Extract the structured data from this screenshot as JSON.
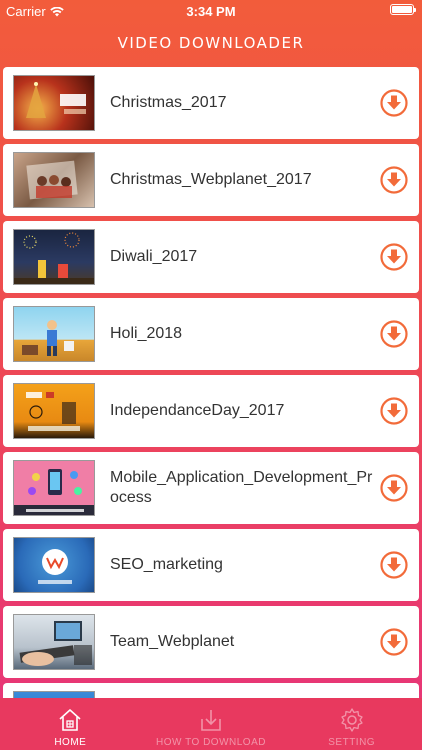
{
  "status_bar": {
    "carrier": "Carrier",
    "time": "3:34 PM"
  },
  "nav": {
    "title": "VIDEO DOWNLOADER"
  },
  "videos": [
    {
      "title": "Christmas_2017"
    },
    {
      "title": "Christmas_Webplanet_2017"
    },
    {
      "title": "Diwali_2017"
    },
    {
      "title": "Holi_2018"
    },
    {
      "title": "IndependanceDay_2017"
    },
    {
      "title": "Mobile_Application_Development_Process"
    },
    {
      "title": "SEO_marketing"
    },
    {
      "title": "Team_Webplanet"
    }
  ],
  "tabs": {
    "home": {
      "label": "HOME",
      "icon": "home-icon"
    },
    "how_to": {
      "label": "HOW TO DOWNLOAD",
      "icon": "download-box-icon"
    },
    "setting": {
      "label": "SETTING",
      "icon": "gear-icon"
    }
  },
  "colors": {
    "accent": "#f26b3a",
    "tab_bar": "#e83a5a"
  }
}
